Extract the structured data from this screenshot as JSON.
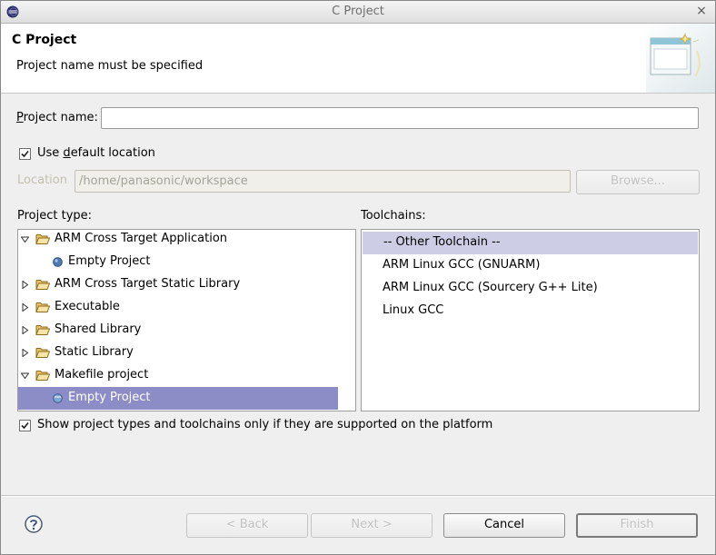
{
  "window": {
    "title": "C Project",
    "close_glyph": "×",
    "app_icon": "eclipse-icon"
  },
  "banner": {
    "title": "C Project",
    "message": "Project name must be specified",
    "image": "new-project-wizard-icon"
  },
  "project_name": {
    "label_pre": "",
    "label_mnemonic": "P",
    "label_post": "roject name:",
    "value": ""
  },
  "use_default_location": {
    "checked": true,
    "label_pre": "Use ",
    "label_mnemonic": "d",
    "label_post": "efault location"
  },
  "location": {
    "label": "Location",
    "value": "/home/panasonic/workspace",
    "browse_label": "Browse..."
  },
  "project_type": {
    "label": "Project type:",
    "items": [
      {
        "label": "ARM Cross Target Application",
        "kind": "folder",
        "expanded": true,
        "level": 0
      },
      {
        "label": "Empty Project",
        "kind": "leaf",
        "level": 1
      },
      {
        "label": "ARM Cross Target Static Library",
        "kind": "folder",
        "expanded": false,
        "level": 0
      },
      {
        "label": "Executable",
        "kind": "folder",
        "expanded": false,
        "level": 0
      },
      {
        "label": "Shared Library",
        "kind": "folder",
        "expanded": false,
        "level": 0
      },
      {
        "label": "Static Library",
        "kind": "folder",
        "expanded": false,
        "level": 0
      },
      {
        "label": "Makefile project",
        "kind": "folder",
        "expanded": true,
        "level": 0
      },
      {
        "label": "Empty Project",
        "kind": "leaf",
        "level": 1,
        "selected": true
      }
    ]
  },
  "toolchains": {
    "label": "Toolchains:",
    "items": [
      {
        "label": "-- Other Toolchain --",
        "selected": true
      },
      {
        "label": "ARM Linux GCC (GNUARM)"
      },
      {
        "label": "ARM Linux GCC (Sourcery G++ Lite)"
      },
      {
        "label": "Linux GCC"
      }
    ]
  },
  "show_supported": {
    "checked": true,
    "label": "Show project types and toolchains only if they are supported on the platform"
  },
  "buttons": {
    "back": "< Back",
    "next": "Next >",
    "cancel": "Cancel",
    "finish": "Finish"
  },
  "colors": {
    "selection": "#8c8cc6",
    "toolchain_selection": "#cdcde6",
    "disabled_text": "#c0c0c0"
  }
}
